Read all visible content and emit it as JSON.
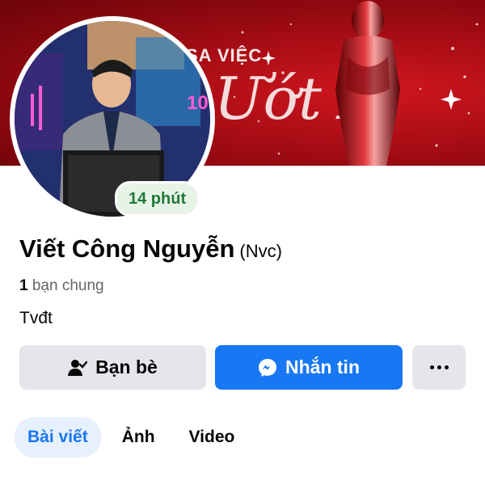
{
  "cover": {
    "top_text": "SA   VIỆC",
    "script_text": "Ướt Á"
  },
  "avatar": {
    "screen_text": "10"
  },
  "status_badge": "14 phút",
  "profile": {
    "name": "Viết Công Nguyễn",
    "nickname": "(Nvc)",
    "mutual_count": "1",
    "mutual_label": "bạn chung",
    "bio": "Tvđt"
  },
  "buttons": {
    "friends_label": "Bạn bè",
    "message_label": "Nhắn tin"
  },
  "tabs": [
    {
      "label": "Bài viết",
      "active": true
    },
    {
      "label": "Ảnh",
      "active": false
    },
    {
      "label": "Video",
      "active": false
    }
  ],
  "colors": {
    "accent": "#1877f2",
    "badge_text": "#1f7a36",
    "cover_red": "#b10e16"
  },
  "icons": [
    "person-check-icon",
    "messenger-icon",
    "more-dots-icon"
  ]
}
